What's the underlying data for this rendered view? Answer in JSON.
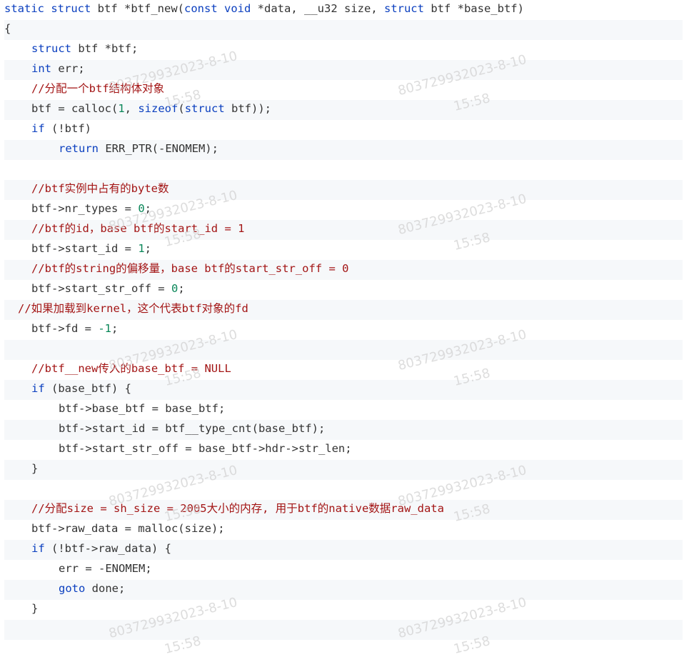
{
  "lines": [
    {
      "indent": 0,
      "alt": false,
      "tokens": [
        {
          "t": "static",
          "c": "kw"
        },
        {
          "t": " "
        },
        {
          "t": "struct",
          "c": "kw"
        },
        {
          "t": " btf *btf_new("
        },
        {
          "t": "const",
          "c": "kw"
        },
        {
          "t": " "
        },
        {
          "t": "void",
          "c": "kw"
        },
        {
          "t": " *data, __u32 size, "
        },
        {
          "t": "struct",
          "c": "kw"
        },
        {
          "t": " btf *base_btf)"
        }
      ]
    },
    {
      "indent": 0,
      "alt": true,
      "tokens": [
        {
          "t": "{"
        }
      ]
    },
    {
      "indent": 1,
      "alt": false,
      "tokens": [
        {
          "t": "struct",
          "c": "kw"
        },
        {
          "t": " btf *btf;"
        }
      ]
    },
    {
      "indent": 1,
      "alt": true,
      "tokens": [
        {
          "t": "int",
          "c": "kw"
        },
        {
          "t": " err;"
        }
      ]
    },
    {
      "indent": 1,
      "alt": false,
      "tokens": [
        {
          "t": "//分配一个btf结构体对象",
          "c": "cm"
        }
      ]
    },
    {
      "indent": 1,
      "alt": true,
      "tokens": [
        {
          "t": "btf = calloc("
        },
        {
          "t": "1",
          "c": "num"
        },
        {
          "t": ", "
        },
        {
          "t": "sizeof",
          "c": "kw"
        },
        {
          "t": "("
        },
        {
          "t": "struct",
          "c": "kw"
        },
        {
          "t": " btf));"
        }
      ]
    },
    {
      "indent": 1,
      "alt": false,
      "tokens": [
        {
          "t": "if",
          "c": "kw"
        },
        {
          "t": " (!btf)"
        }
      ]
    },
    {
      "indent": 2,
      "alt": true,
      "tokens": [
        {
          "t": "return",
          "c": "kw"
        },
        {
          "t": " ERR_PTR(-ENOMEM);"
        }
      ]
    },
    {
      "indent": 0,
      "alt": false,
      "tokens": []
    },
    {
      "indent": 1,
      "alt": true,
      "tokens": [
        {
          "t": "//btf实例中占有的byte数",
          "c": "cm"
        }
      ]
    },
    {
      "indent": 1,
      "alt": false,
      "tokens": [
        {
          "t": "btf->nr_types = "
        },
        {
          "t": "0",
          "c": "num"
        },
        {
          "t": ";"
        }
      ]
    },
    {
      "indent": 1,
      "alt": true,
      "tokens": [
        {
          "t": "//btf的id，base btf的start_id = 1",
          "c": "cm"
        }
      ]
    },
    {
      "indent": 1,
      "alt": false,
      "tokens": [
        {
          "t": "btf->start_id = "
        },
        {
          "t": "1",
          "c": "num"
        },
        {
          "t": ";"
        }
      ]
    },
    {
      "indent": 1,
      "alt": true,
      "tokens": [
        {
          "t": "//btf的string的偏移量，base btf的start_str_off = 0",
          "c": "cm"
        }
      ]
    },
    {
      "indent": 1,
      "alt": false,
      "tokens": [
        {
          "t": "btf->start_str_off = "
        },
        {
          "t": "0",
          "c": "num"
        },
        {
          "t": ";"
        }
      ]
    },
    {
      "indent": 0.5,
      "alt": true,
      "tokens": [
        {
          "t": "//如果加载到kernel，这个代表btf对象的fd",
          "c": "cm"
        }
      ]
    },
    {
      "indent": 1,
      "alt": false,
      "tokens": [
        {
          "t": "btf->fd = "
        },
        {
          "t": "-1",
          "c": "num"
        },
        {
          "t": ";"
        }
      ]
    },
    {
      "indent": 0,
      "alt": true,
      "tokens": []
    },
    {
      "indent": 1,
      "alt": false,
      "tokens": [
        {
          "t": "//btf__new传入的base_btf = NULL",
          "c": "cm"
        }
      ]
    },
    {
      "indent": 1,
      "alt": true,
      "tokens": [
        {
          "t": "if",
          "c": "kw"
        },
        {
          "t": " (base_btf) {"
        }
      ]
    },
    {
      "indent": 2,
      "alt": false,
      "tokens": [
        {
          "t": "btf->base_btf = base_btf;"
        }
      ]
    },
    {
      "indent": 2,
      "alt": true,
      "tokens": [
        {
          "t": "btf->start_id = btf__type_cnt(base_btf);"
        }
      ]
    },
    {
      "indent": 2,
      "alt": false,
      "tokens": [
        {
          "t": "btf->start_str_off = base_btf->hdr->str_len;"
        }
      ]
    },
    {
      "indent": 1,
      "alt": true,
      "tokens": [
        {
          "t": "}"
        }
      ]
    },
    {
      "indent": 0,
      "alt": false,
      "tokens": []
    },
    {
      "indent": 1,
      "alt": true,
      "tokens": [
        {
          "t": "//分配size = sh_size = 2005大小的内存, 用于btf的native数据raw_data",
          "c": "cm"
        }
      ]
    },
    {
      "indent": 1,
      "alt": false,
      "tokens": [
        {
          "t": "btf->raw_data = malloc(size);"
        }
      ]
    },
    {
      "indent": 1,
      "alt": true,
      "tokens": [
        {
          "t": "if",
          "c": "kw"
        },
        {
          "t": " (!btf->raw_data) {"
        }
      ]
    },
    {
      "indent": 2,
      "alt": false,
      "tokens": [
        {
          "t": "err = -ENOMEM;"
        }
      ]
    },
    {
      "indent": 2,
      "alt": true,
      "tokens": [
        {
          "t": "goto",
          "c": "kw"
        },
        {
          "t": " done;"
        }
      ]
    },
    {
      "indent": 1,
      "alt": false,
      "tokens": [
        {
          "t": "}"
        }
      ]
    },
    {
      "indent": 0,
      "alt": true,
      "tokens": []
    }
  ],
  "watermarks": {
    "id_date": "803729932023-8-10",
    "time": "15:58"
  },
  "colors": {
    "keyword": "#0b3fbf",
    "comment": "#a31515",
    "number": "#098658",
    "text": "#333333",
    "alt_row": "#f6f8fa"
  }
}
